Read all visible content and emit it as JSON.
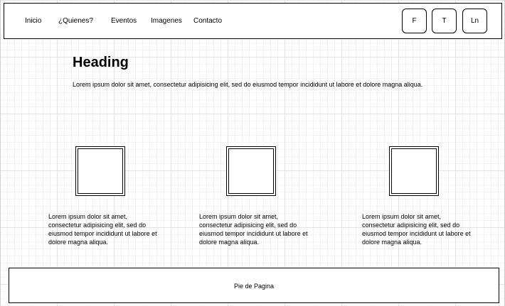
{
  "nav": {
    "items": [
      {
        "label": "Inicio"
      },
      {
        "label": "¿Quienes?"
      },
      {
        "label": "Eventos"
      },
      {
        "label": "Imagenes"
      },
      {
        "label": "Contacto"
      }
    ],
    "social": [
      {
        "label": "F"
      },
      {
        "label": "T"
      },
      {
        "label": "Ln"
      }
    ]
  },
  "main": {
    "heading": "Heading",
    "intro": "Lorem ipsum dolor sit amet, consectetur adipisicing elit, sed do eiusmod tempor incididunt ut labore et dolore magna aliqua."
  },
  "cards": [
    {
      "text": "Lorem ipsum dolor sit amet, consectetur adipisicing elit, sed do eiusmod tempor incididunt ut labore et dolore magna aliqua."
    },
    {
      "text": "Lorem ipsum dolor sit amet, consectetur adipisicing elit, sed do eiusmod tempor incididunt ut labore et dolore magna aliqua."
    },
    {
      "text": "Lorem ipsum dolor sit amet, consectetur adipisicing elit, sed do eiusmod tempor incididunt ut labore et dolore magna aliqua."
    }
  ],
  "footer": {
    "text": "Pie de Pagina"
  }
}
